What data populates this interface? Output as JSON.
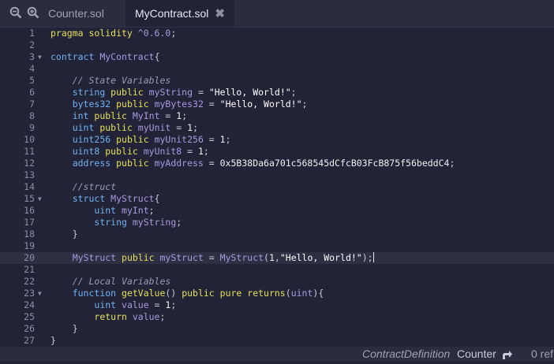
{
  "toolbar": {
    "zoom_out_icon": "zoom-out-icon",
    "zoom_in_icon": "zoom-in-icon"
  },
  "tabs": [
    {
      "label": "Counter.sol",
      "active": false
    },
    {
      "label": "MyContract.sol",
      "active": true,
      "close": "✖"
    }
  ],
  "editor": {
    "highlighted_line": 20,
    "lines": [
      {
        "n": "1",
        "tokens": [
          [
            "k",
            "pragma solidity "
          ],
          [
            "v",
            "^0.6.0"
          ],
          [
            "p",
            ";"
          ]
        ]
      },
      {
        "n": "2",
        "tokens": []
      },
      {
        "n": "3",
        "fold": true,
        "tokens": [
          [
            "t",
            "contract "
          ],
          [
            "v",
            "MyContract"
          ],
          [
            "p",
            "{"
          ]
        ]
      },
      {
        "n": "4",
        "tokens": []
      },
      {
        "n": "5",
        "tokens": [
          [
            "p",
            "    "
          ],
          [
            "c",
            "// State Variables"
          ]
        ]
      },
      {
        "n": "6",
        "tokens": [
          [
            "p",
            "    "
          ],
          [
            "t",
            "string "
          ],
          [
            "k",
            "public "
          ],
          [
            "v",
            "myString"
          ],
          [
            "p",
            " = "
          ],
          [
            "s",
            "\"Hello, World!\""
          ],
          [
            "p",
            ";"
          ]
        ]
      },
      {
        "n": "7",
        "tokens": [
          [
            "p",
            "    "
          ],
          [
            "t",
            "bytes32 "
          ],
          [
            "k",
            "public "
          ],
          [
            "v",
            "myBytes32"
          ],
          [
            "p",
            " = "
          ],
          [
            "s",
            "\"Hello, World!\""
          ],
          [
            "p",
            ";"
          ]
        ]
      },
      {
        "n": "8",
        "tokens": [
          [
            "p",
            "    "
          ],
          [
            "t",
            "int "
          ],
          [
            "k",
            "public "
          ],
          [
            "v",
            "MyInt"
          ],
          [
            "p",
            " = "
          ],
          [
            "n",
            "1"
          ],
          [
            "p",
            ";"
          ]
        ]
      },
      {
        "n": "9",
        "tokens": [
          [
            "p",
            "    "
          ],
          [
            "t",
            "uint "
          ],
          [
            "k",
            "public "
          ],
          [
            "v",
            "myUnit"
          ],
          [
            "p",
            " = "
          ],
          [
            "n",
            "1"
          ],
          [
            "p",
            ";"
          ]
        ]
      },
      {
        "n": "10",
        "tokens": [
          [
            "p",
            "    "
          ],
          [
            "t",
            "uint256 "
          ],
          [
            "k",
            "public "
          ],
          [
            "v",
            "myUnit256"
          ],
          [
            "p",
            " = "
          ],
          [
            "n",
            "1"
          ],
          [
            "p",
            ";"
          ]
        ]
      },
      {
        "n": "11",
        "tokens": [
          [
            "p",
            "    "
          ],
          [
            "t",
            "uint8 "
          ],
          [
            "k",
            "public "
          ],
          [
            "v",
            "myUnit8"
          ],
          [
            "p",
            " = "
          ],
          [
            "n",
            "1"
          ],
          [
            "p",
            ";"
          ]
        ]
      },
      {
        "n": "12",
        "tokens": [
          [
            "p",
            "    "
          ],
          [
            "t",
            "address "
          ],
          [
            "k",
            "public "
          ],
          [
            "v",
            "myAddress"
          ],
          [
            "p",
            " = "
          ],
          [
            "n",
            "0x5B38Da6a701c568545dCfcB03FcB875f56beddC4"
          ],
          [
            "p",
            ";"
          ]
        ]
      },
      {
        "n": "13",
        "tokens": []
      },
      {
        "n": "14",
        "tokens": [
          [
            "p",
            "    "
          ],
          [
            "c",
            "//struct"
          ]
        ]
      },
      {
        "n": "15",
        "fold": true,
        "tokens": [
          [
            "p",
            "    "
          ],
          [
            "t",
            "struct "
          ],
          [
            "v",
            "MyStruct"
          ],
          [
            "p",
            "{"
          ]
        ]
      },
      {
        "n": "16",
        "tokens": [
          [
            "p",
            "        "
          ],
          [
            "t",
            "uint "
          ],
          [
            "v",
            "myInt"
          ],
          [
            "p",
            ";"
          ]
        ]
      },
      {
        "n": "17",
        "tokens": [
          [
            "p",
            "        "
          ],
          [
            "t",
            "string "
          ],
          [
            "v",
            "myString"
          ],
          [
            "p",
            ";"
          ]
        ]
      },
      {
        "n": "18",
        "tokens": [
          [
            "p",
            "    }"
          ]
        ]
      },
      {
        "n": "19",
        "tokens": []
      },
      {
        "n": "20",
        "cursor": true,
        "tokens": [
          [
            "p",
            "    "
          ],
          [
            "v",
            "MyStruct "
          ],
          [
            "k",
            "public "
          ],
          [
            "v",
            "myStruct"
          ],
          [
            "p",
            " = "
          ],
          [
            "v",
            "MyStruct"
          ],
          [
            "p",
            "("
          ],
          [
            "n",
            "1"
          ],
          [
            "p",
            ","
          ],
          [
            "s",
            "\"Hello, World!\""
          ],
          [
            "p",
            ");"
          ]
        ]
      },
      {
        "n": "21",
        "tokens": []
      },
      {
        "n": "22",
        "tokens": [
          [
            "p",
            "    "
          ],
          [
            "c",
            "// Local Variables"
          ]
        ]
      },
      {
        "n": "23",
        "fold": true,
        "tokens": [
          [
            "p",
            "    "
          ],
          [
            "t",
            "function "
          ],
          [
            "k",
            "getValue"
          ],
          [
            "p",
            "() "
          ],
          [
            "k",
            "public pure returns"
          ],
          [
            "p",
            "("
          ],
          [
            "v",
            "uint"
          ],
          [
            "p",
            ")"
          ],
          [
            "p",
            "{"
          ]
        ]
      },
      {
        "n": "24",
        "tokens": [
          [
            "p",
            "        "
          ],
          [
            "t",
            "uint "
          ],
          [
            "v",
            "value"
          ],
          [
            "p",
            " = "
          ],
          [
            "n",
            "1"
          ],
          [
            "p",
            ";"
          ]
        ]
      },
      {
        "n": "25",
        "tokens": [
          [
            "p",
            "        "
          ],
          [
            "k",
            "return "
          ],
          [
            "v",
            "value"
          ],
          [
            "p",
            ";"
          ]
        ]
      },
      {
        "n": "26",
        "tokens": [
          [
            "p",
            "    }"
          ]
        ]
      },
      {
        "n": "27",
        "tokens": [
          [
            "p",
            "}"
          ]
        ]
      }
    ]
  },
  "status": {
    "definition": "ContractDefinition",
    "name": "Counter",
    "refs": "0 ref",
    "icon": "goto-arrow-icon"
  },
  "colors": {
    "background": "#222336",
    "tabbar": "#2a2c3f",
    "keyword": "#e6e05a",
    "type": "#6fb3f2",
    "identifier": "#a79ae0",
    "comment": "#9a9cb3"
  }
}
